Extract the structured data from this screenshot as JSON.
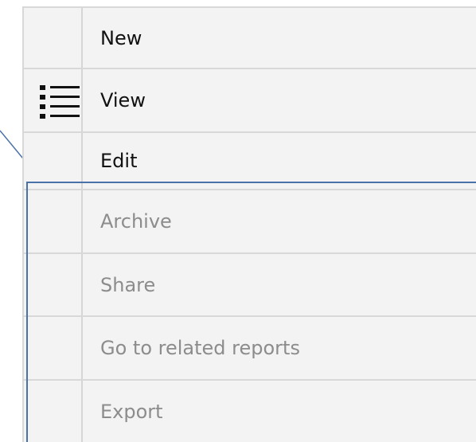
{
  "menu": {
    "items": [
      {
        "label": "New",
        "enabled": true,
        "icon": ""
      },
      {
        "label": "View",
        "enabled": true,
        "icon": "list-icon"
      },
      {
        "label": "Edit",
        "enabled": true,
        "icon": ""
      },
      {
        "label": "Archive",
        "enabled": false,
        "icon": ""
      },
      {
        "label": "Share",
        "enabled": false,
        "icon": ""
      },
      {
        "label": "Go to related reports",
        "enabled": false,
        "icon": ""
      },
      {
        "label": "Export",
        "enabled": false,
        "icon": ""
      }
    ]
  },
  "colors": {
    "menu_background": "#f3f3f3",
    "enabled_text": "#111111",
    "disabled_text": "#8c8c8c",
    "separator": "#d8d8d8",
    "selection_outline": "#4a72a8"
  }
}
